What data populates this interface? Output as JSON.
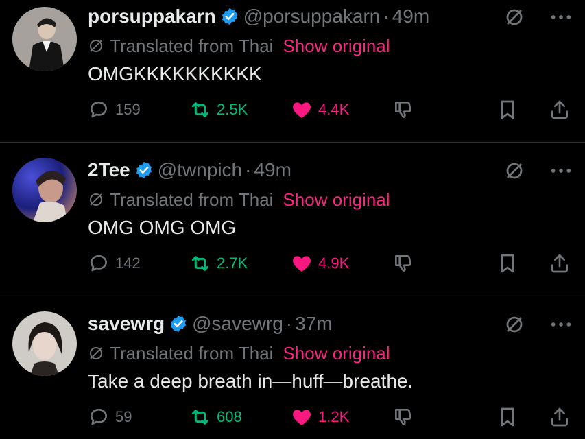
{
  "tweets": [
    {
      "name": "porsuppakarn",
      "handle": "@porsuppakarn",
      "time": "49m",
      "translated_label": "Translated from Thai",
      "show_original_label": "Show original",
      "text": "OMGKKKKKKKKKK",
      "replies": "159",
      "retweets": "2.5K",
      "likes": "4.4K"
    },
    {
      "name": "2Tee",
      "handle": "@twnpich",
      "time": "49m",
      "translated_label": "Translated from Thai",
      "show_original_label": "Show original",
      "text": "OMG OMG OMG",
      "replies": "142",
      "retweets": "2.7K",
      "likes": "4.9K"
    },
    {
      "name": "savewrg",
      "handle": "@savewrg",
      "time": "37m",
      "translated_label": "Translated from Thai",
      "show_original_label": "Show original",
      "text": "Take a deep breath in—huff—breathe.",
      "replies": "59",
      "retweets": "608",
      "likes": "1.2K"
    }
  ],
  "colors": {
    "background": "#000000",
    "text": "#e7e9ea",
    "muted": "#71767b",
    "retweet": "#00ba7c",
    "like": "#f91880",
    "link_pink": "#f4267f",
    "verified": "#1d9bf0"
  },
  "icons": {
    "reply": "reply-icon",
    "retweet": "retweet-icon",
    "like": "heart-icon",
    "dislike": "dislike-icon",
    "bookmark": "bookmark-icon",
    "share": "share-icon",
    "verified": "verified-badge-icon",
    "translate": "untranslate-icon",
    "more": "more-icon"
  }
}
